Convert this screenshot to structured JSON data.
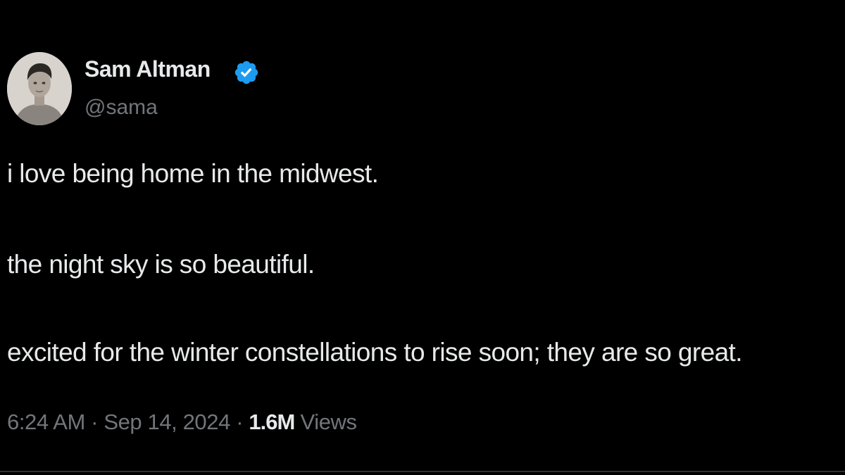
{
  "author": {
    "name": "Sam Altman",
    "handle": "@sama",
    "verified": true,
    "verified_color": "#1d9bf0",
    "avatar_icon": "profile-photo"
  },
  "tweet": {
    "lines": [
      "i love being home in the midwest.",
      "the night sky is so beautiful.",
      "excited for the winter constellations to rise soon; they are so great."
    ]
  },
  "meta": {
    "time": "6:24 AM",
    "separator": "·",
    "date": "Sep 14, 2024",
    "views_count": "1.6M",
    "views_label": "Views"
  },
  "colors": {
    "background": "#000000",
    "primary_text": "#e7e9ea",
    "secondary_text": "#71767b",
    "divider": "#2f3336"
  }
}
